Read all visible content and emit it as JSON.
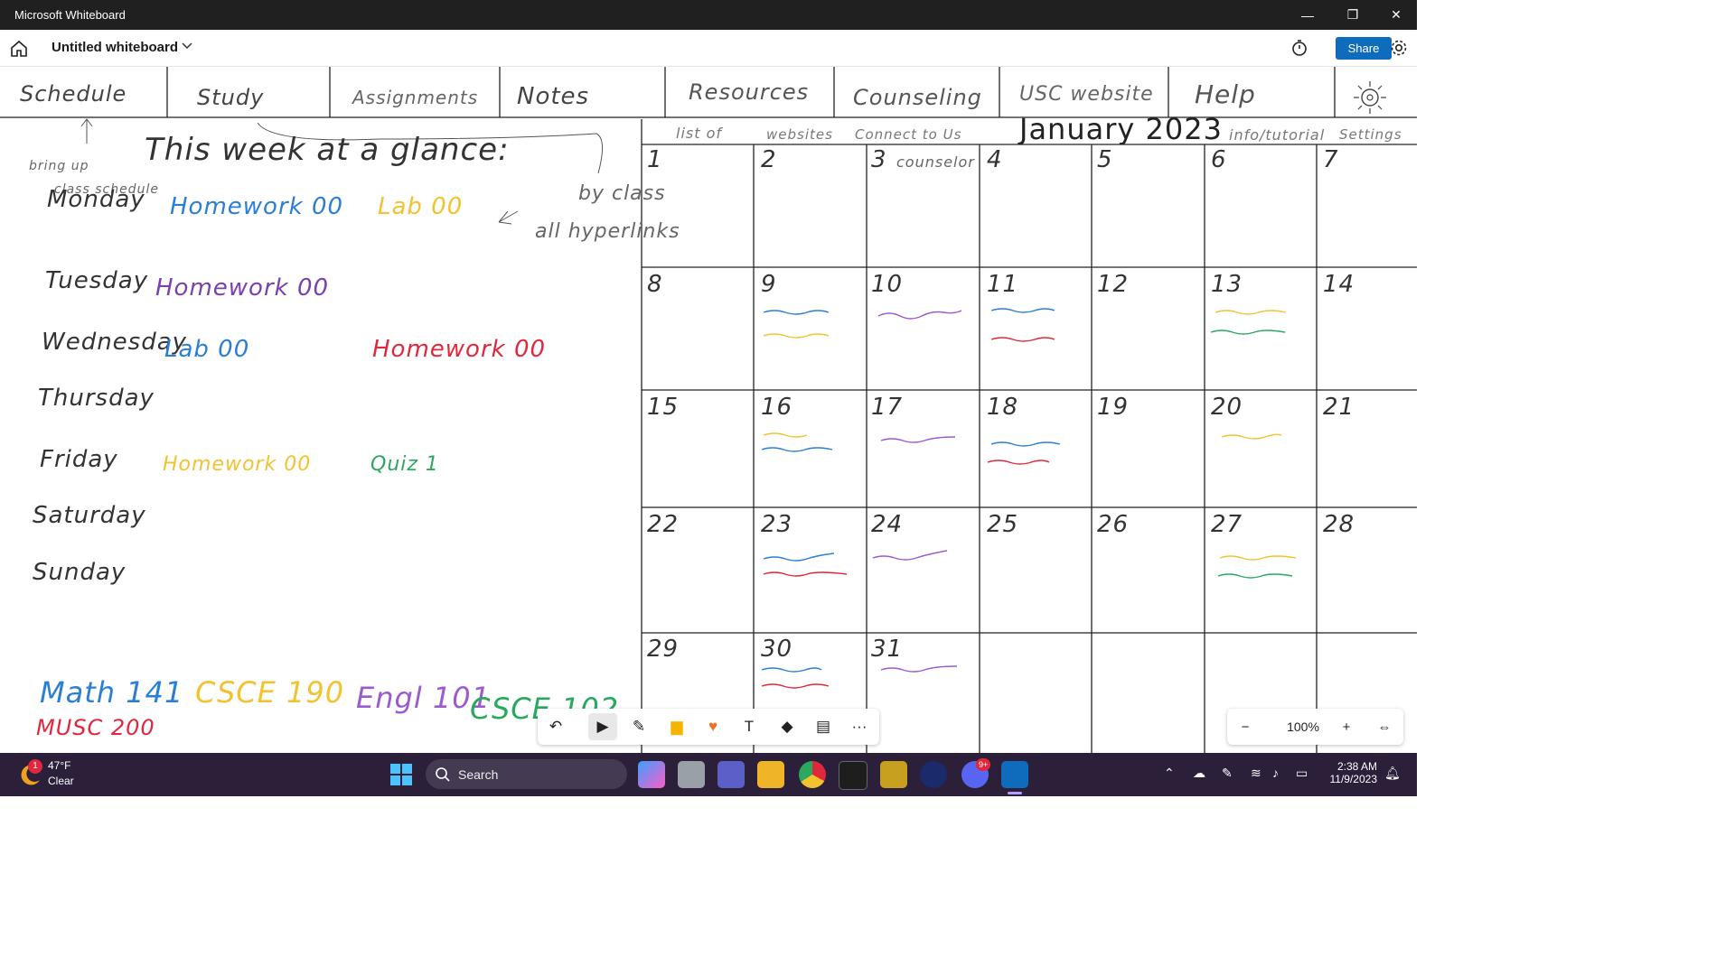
{
  "window": {
    "title": "Microsoft Whiteboard",
    "minimize": "—",
    "restore": "❐",
    "close": "✕"
  },
  "appbar": {
    "board_name": "Untitled whiteboard",
    "share_label": "Share"
  },
  "nav_tabs": [
    "Schedule",
    "Study",
    "Assignments",
    "Notes",
    "Resources",
    "Counseling",
    "USC website",
    "Help"
  ],
  "nav_notes": {
    "bring_up": "bring up",
    "class_schedule": "class schedule",
    "list_of": "list of",
    "websites": "websites",
    "connect": "Connect to Us",
    "info": "info/tutorial",
    "settings": "Settings",
    "by_class": "by class",
    "all_hyperlinks": "all hyperlinks"
  },
  "week": {
    "heading": "This week at a glance:",
    "days": [
      {
        "day": "Monday",
        "items": [
          {
            "text": "Homework 00",
            "color": "#2a7fd4"
          },
          {
            "text": "Lab 00",
            "color": "#f2c230"
          }
        ]
      },
      {
        "day": "Tuesday",
        "items": [
          {
            "text": "Homework 00",
            "color": "#7a3fb0"
          }
        ]
      },
      {
        "day": "Wednesday",
        "items": [
          {
            "text": "Lab 00",
            "color": "#2a7fd4"
          },
          {
            "text": "Homework 00",
            "color": "#e0283c"
          }
        ]
      },
      {
        "day": "Thursday",
        "items": []
      },
      {
        "day": "Friday",
        "items": [
          {
            "text": "Homework 00",
            "color": "#f2c230"
          },
          {
            "text": "Quiz 1",
            "color": "#2aa860"
          }
        ]
      },
      {
        "day": "Saturday",
        "items": []
      },
      {
        "day": "Sunday",
        "items": []
      }
    ]
  },
  "courses": [
    {
      "text": "Math 141",
      "color": "#2a7fd4"
    },
    {
      "text": "CSCE 190",
      "color": "#f2c230"
    },
    {
      "text": "Engl 101",
      "color": "#9b5ad0"
    },
    {
      "text": "CSCE 102",
      "color": "#2aa860"
    },
    {
      "text": "MUSC 200",
      "color": "#e0283c"
    }
  ],
  "calendar": {
    "title": "January 2023",
    "days": [
      "1",
      "2",
      "3",
      "4",
      "5",
      "6",
      "7",
      "8",
      "9",
      "10",
      "11",
      "12",
      "13",
      "14",
      "15",
      "16",
      "17",
      "18",
      "19",
      "20",
      "21",
      "22",
      "23",
      "24",
      "25",
      "26",
      "27",
      "28",
      "29",
      "30",
      "31"
    ],
    "day3_note": "counselor"
  },
  "toolbar": {
    "undo": "↶",
    "select": "▶",
    "pen": "✎",
    "note": "▆",
    "reaction": "♥",
    "text": "T",
    "shapes": "◆",
    "template": "▤",
    "more": "···"
  },
  "zoom": {
    "out": "−",
    "value": "100%",
    "in": "+",
    "fit": "⇔"
  },
  "taskbar": {
    "weather_temp": "47°F",
    "weather_cond": "Clear",
    "weather_badge": "1",
    "search_label": "Search",
    "time": "2:38 AM",
    "date": "11/9/2023",
    "discord_badge": "9+"
  },
  "colors": {
    "blue": "#2a7fd4",
    "yellow": "#f2c230",
    "purple": "#7a3fb0",
    "red": "#e0283c",
    "green": "#2aa860",
    "accent": "#0f6cbd"
  }
}
